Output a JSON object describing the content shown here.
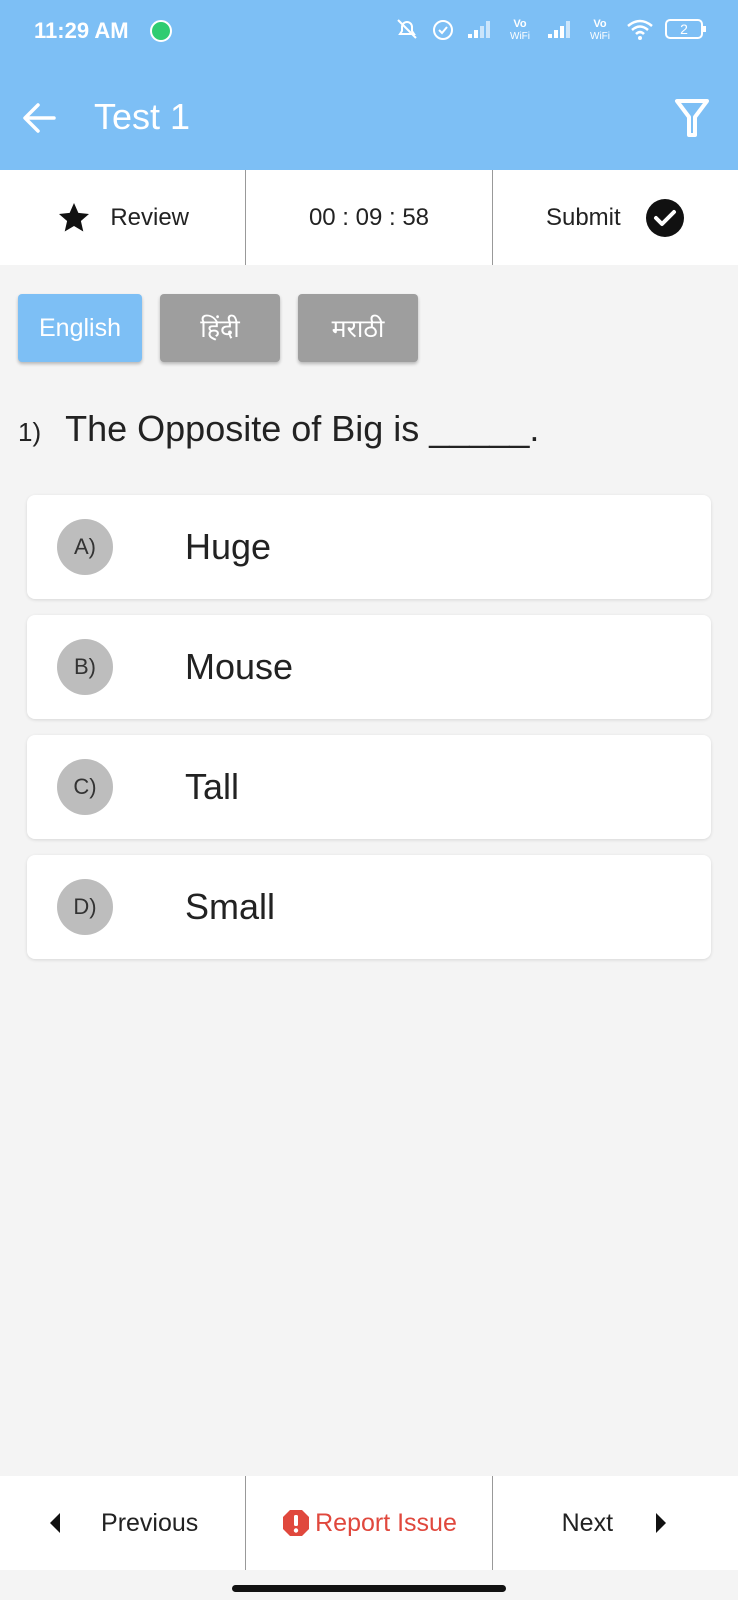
{
  "status_bar": {
    "time": "11:29 AM",
    "icons": [
      "whatsapp-icon",
      "mute-icon",
      "alarm-icon",
      "signal-icon",
      "vowifi-icon",
      "signal-icon",
      "vowifi-icon",
      "wifi-icon",
      "battery-icon"
    ],
    "vowifi_label_top": "Vo",
    "vowifi_label_bottom": "WiFi",
    "battery_level": "2"
  },
  "app_bar": {
    "title": "Test 1",
    "back_icon": "arrow-left-icon",
    "filter_icon": "filter-icon",
    "background": "#7dbff5"
  },
  "toolbar": {
    "review_label": "Review",
    "timer": "00 : 09 : 58",
    "submit_label": "Submit"
  },
  "languages": [
    {
      "label": "English",
      "active": true
    },
    {
      "label": "हिंदी",
      "active": false
    },
    {
      "label": "मराठी",
      "active": false
    }
  ],
  "question": {
    "number": "1)",
    "text": "The Opposite of Big is _____."
  },
  "options": [
    {
      "letter": "A)",
      "text": "Huge"
    },
    {
      "letter": "B)",
      "text": "Mouse"
    },
    {
      "letter": "C)",
      "text": "Tall"
    },
    {
      "letter": "D)",
      "text": "Small"
    }
  ],
  "bottom_bar": {
    "previous_label": "Previous",
    "report_label": "Report Issue",
    "next_label": "Next",
    "report_color": "#e0483d"
  }
}
